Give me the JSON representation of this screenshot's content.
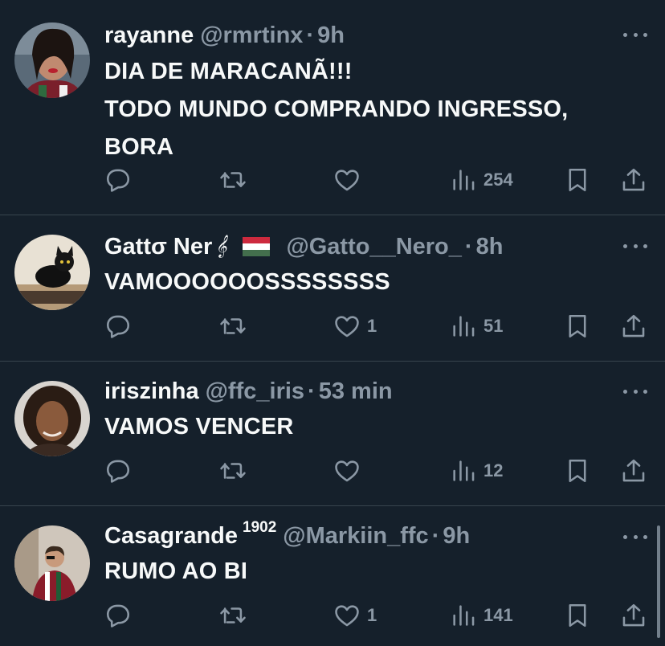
{
  "tweets": [
    {
      "name": "rayanne",
      "handle": "@rmrtinx",
      "time": "9h",
      "text": "DIA DE MARACANÃ!!!\nTODO MUNDO COMPRANDO INGRESSO,\nBORA",
      "likes": "",
      "views": "254"
    },
    {
      "name": "Gattσ Ner",
      "name_symbol": "𝄞",
      "flag": "hungary-flag",
      "handle": "@Gatto__Nero_",
      "time": "8h",
      "text": "VAMOOOOOOSSSSSSSS",
      "likes": "1",
      "views": "51"
    },
    {
      "name": "iriszinha",
      "handle": "@ffc_iris",
      "time": "53 min",
      "text": "VAMOS VENCER",
      "likes": "",
      "views": "12"
    },
    {
      "name": "Casagrande",
      "name_sup": "1902",
      "handle": "@Markiin_ffc",
      "time": "9h",
      "text": "RUMO AO BI",
      "likes": "1",
      "views": "141"
    }
  ],
  "separator": "·",
  "icons": [
    "reply-icon",
    "retweet-icon",
    "like-icon",
    "views-icon",
    "bookmark-icon",
    "share-icon",
    "more-icon"
  ],
  "colors": {
    "background": "#15202b",
    "text": "#f7f9f9",
    "muted": "#8b98a5",
    "divider": "#38444d"
  }
}
